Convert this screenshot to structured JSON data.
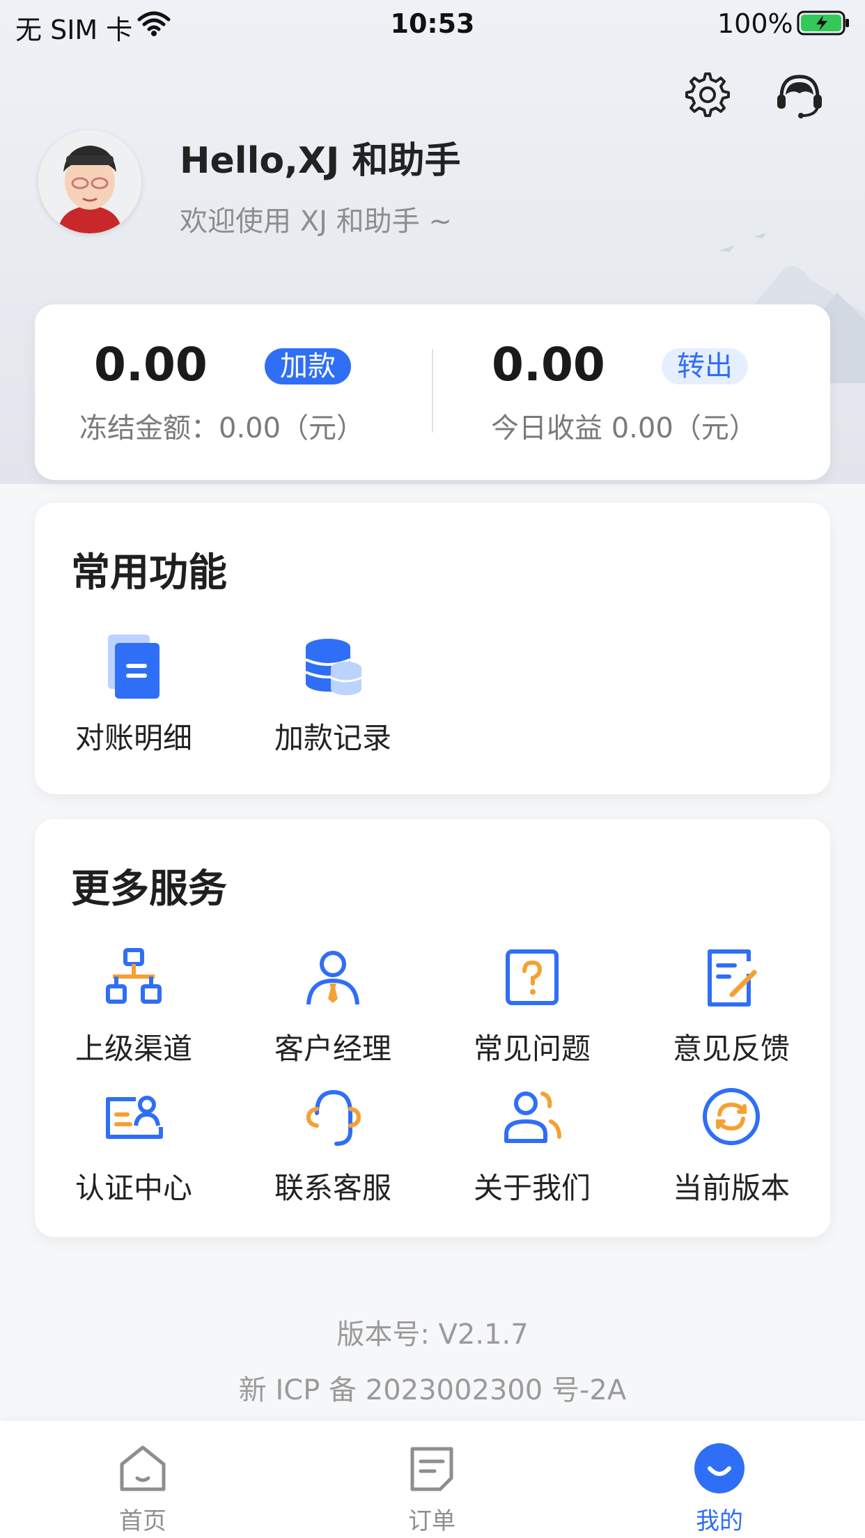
{
  "status_bar": {
    "carrier": "无 SIM 卡",
    "time": "10:53",
    "battery": "100%"
  },
  "header": {
    "greeting": "Hello,XJ 和助手",
    "welcome": "欢迎使用 XJ 和助手 ~",
    "icons": [
      "gear-icon",
      "customer-service-icon"
    ]
  },
  "balance": {
    "left": {
      "amount": "0.00",
      "button": "加款",
      "sub": "冻结金额：0.00（元）"
    },
    "right": {
      "amount": "0.00",
      "button": "转出",
      "sub": "今日收益 0.00（元）"
    }
  },
  "common_functions": {
    "title": "常用功能",
    "items": [
      {
        "label": "对账明细",
        "icon": "document-icon"
      },
      {
        "label": "加款记录",
        "icon": "coins-icon"
      }
    ]
  },
  "more_services": {
    "title": "更多服务",
    "items": [
      {
        "label": "上级渠道",
        "icon": "org-chart-icon"
      },
      {
        "label": "客户经理",
        "icon": "manager-icon"
      },
      {
        "label": "常见问题",
        "icon": "question-icon"
      },
      {
        "label": "意见反馈",
        "icon": "feedback-icon"
      },
      {
        "label": "认证中心",
        "icon": "id-card-icon"
      },
      {
        "label": "联系客服",
        "icon": "headset-icon"
      },
      {
        "label": "关于我们",
        "icon": "team-icon"
      },
      {
        "label": "当前版本",
        "icon": "refresh-icon"
      }
    ]
  },
  "footer": {
    "version": "版本号: V2.1.7",
    "icp": "新 ICP 备 2023002300 号-2A"
  },
  "tabbar": {
    "items": [
      {
        "label": "首页",
        "icon": "home-icon",
        "active": false
      },
      {
        "label": "订单",
        "icon": "order-icon",
        "active": false
      },
      {
        "label": "我的",
        "icon": "profile-icon",
        "active": true
      }
    ]
  },
  "colors": {
    "accent": "#2f6ef6",
    "orange": "#f5a033",
    "tab_inactive": "#8e8e8e"
  }
}
